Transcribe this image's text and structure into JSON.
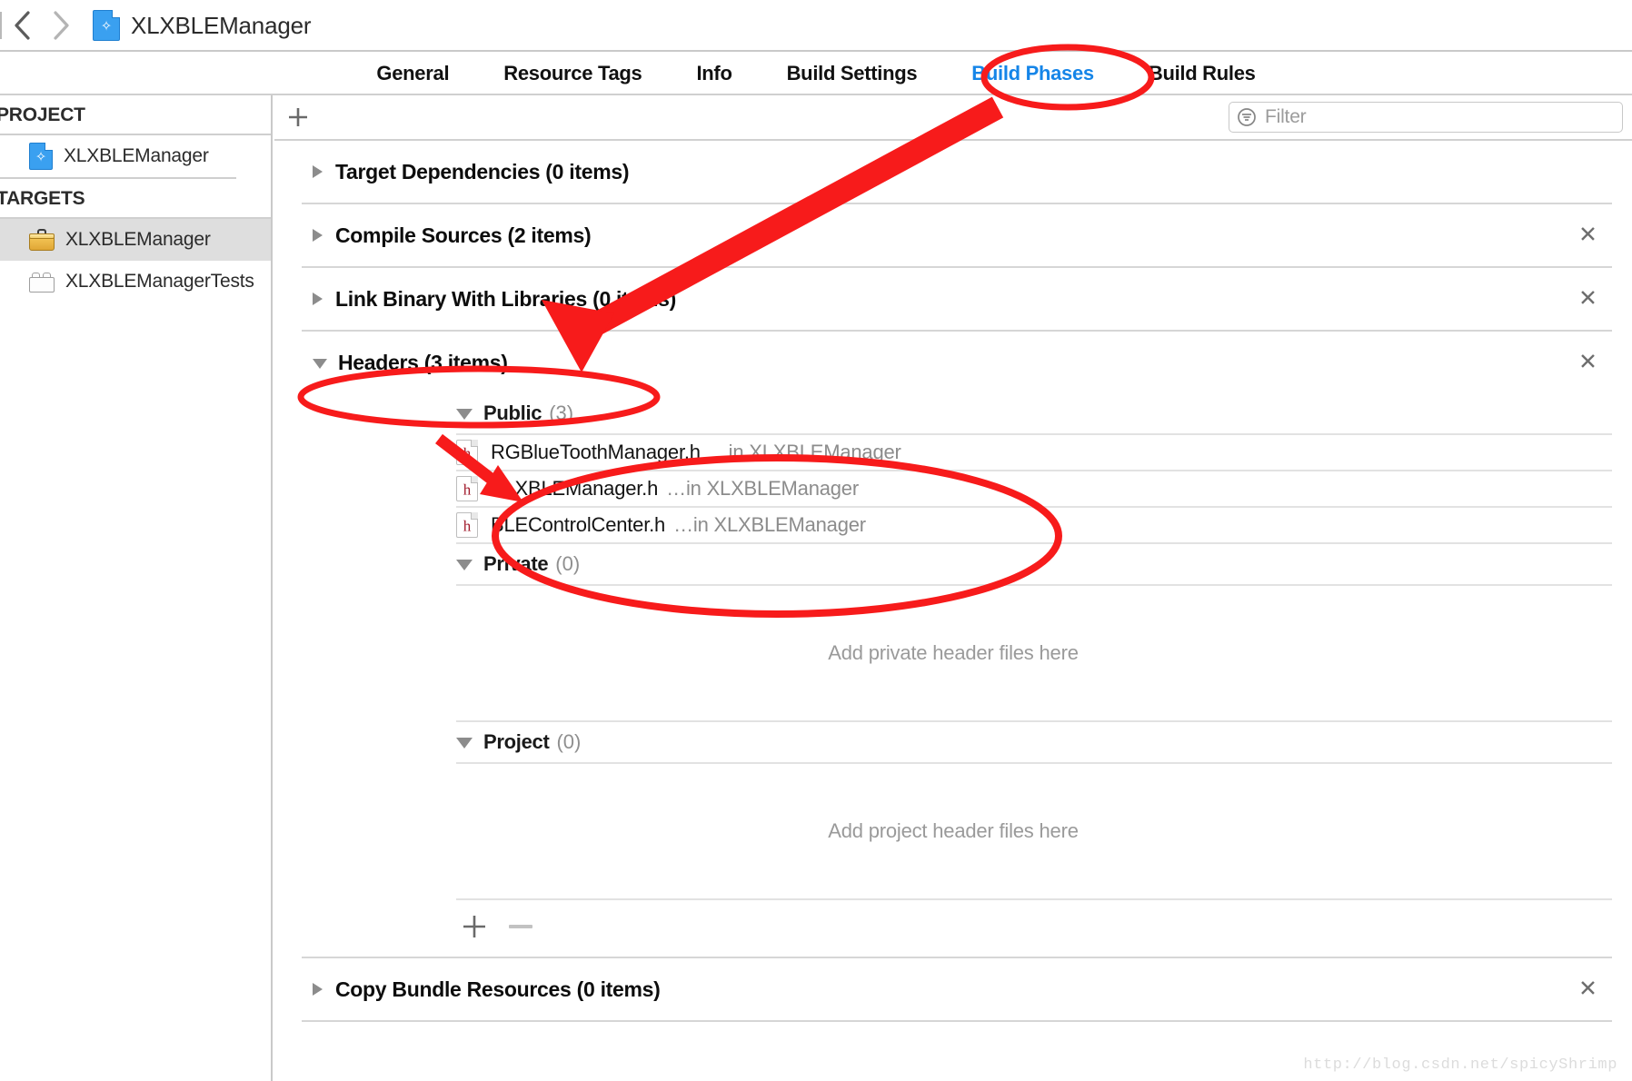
{
  "window": {
    "title": "XLXBLEManager",
    "back_icon": "chevron-left-icon",
    "forward_icon": "chevron-right-icon",
    "doc_icon": "app-document-icon"
  },
  "tabs": [
    {
      "label": "General",
      "selected": false
    },
    {
      "label": "Resource Tags",
      "selected": false
    },
    {
      "label": "Info",
      "selected": false
    },
    {
      "label": "Build Settings",
      "selected": false
    },
    {
      "label": "Build Phases",
      "selected": true
    },
    {
      "label": "Build Rules",
      "selected": false
    }
  ],
  "sidebar": {
    "project_header": "PROJECT",
    "targets_header": "TARGETS",
    "project_items": [
      {
        "label": "XLXBLEManager",
        "icon": "app-document-icon"
      }
    ],
    "target_items": [
      {
        "label": "XLXBLEManager",
        "icon": "toolbox-icon",
        "selected": true
      },
      {
        "label": "XLXBLEManagerTests",
        "icon": "test-bundle-icon",
        "selected": false
      }
    ]
  },
  "toolbar": {
    "add_label": "+",
    "add_icon": "plus-icon",
    "filter_placeholder": "Filter",
    "filter_value": "",
    "filter_icon": "filter-icon"
  },
  "phases": [
    {
      "title": "Target Dependencies (0 items)",
      "expanded": false,
      "removable": false
    },
    {
      "title": "Compile Sources (2 items)",
      "expanded": false,
      "removable": true
    },
    {
      "title": "Link Binary With Libraries (0 items)",
      "expanded": false,
      "removable": true
    },
    {
      "title": "Headers (3 items)",
      "expanded": true,
      "removable": true
    },
    {
      "title": "Copy Bundle Resources (0 items)",
      "expanded": false,
      "removable": true
    }
  ],
  "headers_phase": {
    "groups": [
      {
        "name": "Public",
        "count": "(3)",
        "files": [
          {
            "name": "RGBlueToothManager.h",
            "location": "…in XLXBLEManager",
            "icon": "header-file-icon"
          },
          {
            "name": "XLXBLEManager.h",
            "location": "…in XLXBLEManager",
            "icon": "header-file-icon"
          },
          {
            "name": "BLEControlCenter.h",
            "location": "…in XLXBLEManager",
            "icon": "header-file-icon"
          }
        ],
        "empty_note": ""
      },
      {
        "name": "Private",
        "count": "(0)",
        "files": [],
        "empty_note": "Add private header files here"
      },
      {
        "name": "Project",
        "count": "(0)",
        "files": [],
        "empty_note": "Add project header files here"
      }
    ],
    "add_button": "+",
    "remove_button": "−"
  },
  "close_icon": "close-x-icon",
  "annotations": {
    "color": "#f71b1b",
    "ellipse_build_phases": "Build Phases tab circled",
    "ellipse_headers": "Headers (3 items) row circled",
    "ellipse_public_files": "Public header files circled",
    "arrow_to_headers": "arrow pointing from Build Phases down to Headers",
    "arrow_to_first_file": "arrow pointing to RGBlueToothManager.h"
  },
  "watermark": "http://blog.csdn.net/spicyShrimp"
}
